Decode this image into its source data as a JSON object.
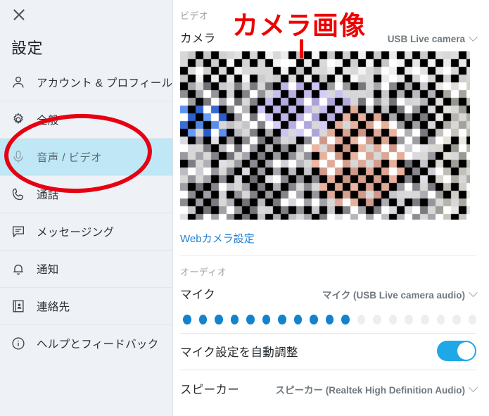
{
  "window": {
    "close_icon": "close-icon",
    "title": "設定"
  },
  "sidebar": {
    "items": [
      {
        "label": "アカウント & プロフィール",
        "icon": "person-icon",
        "selected": false
      },
      {
        "label": "全般",
        "icon": "gear-icon",
        "selected": false
      },
      {
        "label": "音声 / ビデオ",
        "icon": "microphone-icon",
        "selected": true
      },
      {
        "label": "通話",
        "icon": "phone-icon",
        "selected": false
      },
      {
        "label": "メッセージング",
        "icon": "chat-bubble-icon",
        "selected": false
      },
      {
        "label": "通知",
        "icon": "bell-icon",
        "selected": false
      },
      {
        "label": "連絡先",
        "icon": "contact-book-icon",
        "selected": false
      },
      {
        "label": "ヘルプとフィードバック",
        "icon": "info-circle-icon",
        "selected": false
      }
    ]
  },
  "content": {
    "video_section_label": "ビデオ",
    "camera_row": {
      "label": "カメラ",
      "value": "USB Live camera",
      "chevron": "chevron-down-icon"
    },
    "webcam_settings_link": "Webカメラ設定",
    "audio_section_label": "オーディオ",
    "microphone_row": {
      "label": "マイク",
      "value": "マイク (USB Live camera audio)",
      "chevron": "chevron-down-icon"
    },
    "mic_level": {
      "total_dots": 19,
      "active_dots": 11,
      "active_color": "#1283cc",
      "inactive_color": "#eceff2"
    },
    "auto_adjust_row": {
      "label": "マイク設定を自動調整",
      "toggle_state": "on",
      "toggle_color": "#1fa8e8"
    },
    "speaker_row": {
      "label": "スピーカー",
      "value": "スピーカー (Realtek High Definition Audio)",
      "chevron": "chevron-down-icon"
    }
  },
  "annotation": {
    "text": "カメラ画像",
    "color": "#ee0000",
    "pointer": "vertical-line-pointer",
    "ellipse_target": "音声 / ビデオ"
  }
}
